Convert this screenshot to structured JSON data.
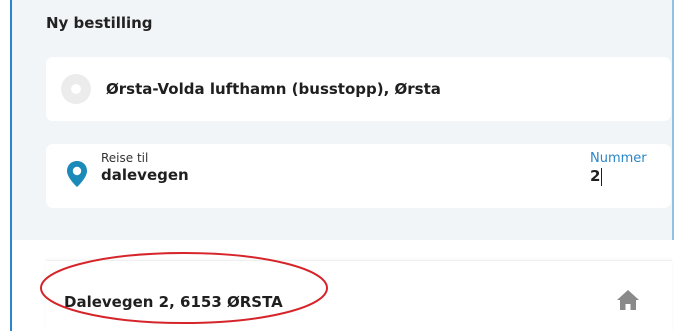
{
  "panel": {
    "title": "Ny bestilling"
  },
  "from": {
    "value": "Ørsta-Volda lufthamn (busstopp), Ørsta",
    "icon": "location-dot-icon"
  },
  "to": {
    "label": "Reise til",
    "value": "dalevegen",
    "icon": "map-pin-icon"
  },
  "number": {
    "label": "Nummer",
    "value": "2"
  },
  "result": {
    "address": "Dalevegen 2, 6153 ØRSTA",
    "icon": "home-icon"
  },
  "colors": {
    "accent": "#2a86c8",
    "pin": "#1b8ab8",
    "panel_bg": "#f1f5f8",
    "annotation": "#d6252a",
    "home_icon": "#8a8a8a"
  }
}
